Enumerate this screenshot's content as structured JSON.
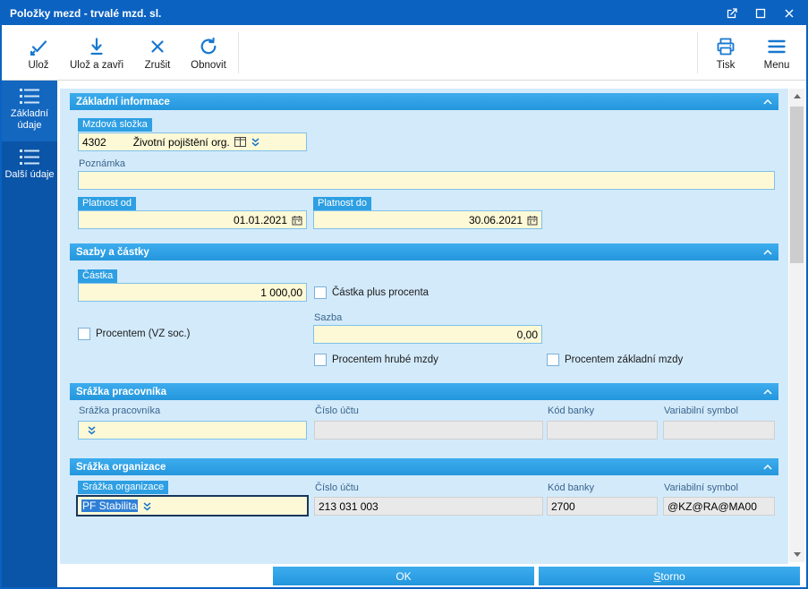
{
  "colors": {
    "titlebar": "#0b62c1",
    "sidebar": "#0a55a8",
    "section_header": "#2e9fe3",
    "panel_bg": "#d3eafb",
    "input_editable": "#fdf9d6",
    "input_readonly": "#e9e9e9",
    "icon_blue": "#1878d0",
    "selection": "#2f7fd6"
  },
  "window": {
    "title": "Položky mezd - trvalé mzd. sl."
  },
  "toolbar": {
    "buttons": [
      {
        "label": "Ulož",
        "icon": "save-icon"
      },
      {
        "label": "Ulož a zavři",
        "icon": "save-close-icon"
      },
      {
        "label": "Zrušit",
        "icon": "cancel-x-icon"
      },
      {
        "label": "Obnovit",
        "icon": "refresh-icon"
      }
    ],
    "right_buttons": [
      {
        "label": "Tisk",
        "icon": "printer-icon"
      },
      {
        "label": "Menu",
        "icon": "menu-icon"
      }
    ]
  },
  "sidebar": {
    "items": [
      {
        "label": "Základní údaje",
        "active": true
      },
      {
        "label": "Další údaje",
        "active": false
      }
    ]
  },
  "sections": {
    "basic": {
      "title": "Základní informace",
      "wage_component_label": "Mzdová složka",
      "wage_component_code": "4302",
      "wage_component_name": "Životní pojištění org.",
      "note_label": "Poznámka",
      "note_value": "",
      "valid_from_label": "Platnost od",
      "valid_from_value": "01.01.2021",
      "valid_to_label": "Platnost do",
      "valid_to_value": "30.06.2021"
    },
    "rates": {
      "title": "Sazby a částky",
      "amount_label": "Částka",
      "amount_value": "1 000,00",
      "amount_plus_percent_label": "Částka plus procenta",
      "amount_plus_percent_checked": false,
      "percent_vz_label": "Procentem (VZ soc.)",
      "percent_vz_checked": false,
      "rate_label": "Sazba",
      "rate_value": "0,00",
      "percent_gross_label": "Procentem hrubé mzdy",
      "percent_gross_checked": false,
      "percent_base_label": "Procentem základní mzdy",
      "percent_base_checked": false
    },
    "employee_deduction": {
      "title": "Srážka pracovníka",
      "deduction_label": "Srážka pracovníka",
      "deduction_value": "",
      "account_label": "Číslo účtu",
      "account_value": "",
      "bank_code_label": "Kód banky",
      "bank_code_value": "",
      "var_symbol_label": "Variabilní symbol",
      "var_symbol_value": ""
    },
    "org_deduction": {
      "title": "Srážka organizace",
      "deduction_label": "Srážka organizace",
      "deduction_value": "PF Stabilita",
      "account_label": "Číslo účtu",
      "account_value": "213 031 003",
      "bank_code_label": "Kód banky",
      "bank_code_value": "2700",
      "var_symbol_label": "Variabilní symbol",
      "var_symbol_value": "@KZ@RA@MA00"
    }
  },
  "footer": {
    "ok_label": "OK",
    "cancel_accel": "S",
    "cancel_rest": "torno"
  }
}
